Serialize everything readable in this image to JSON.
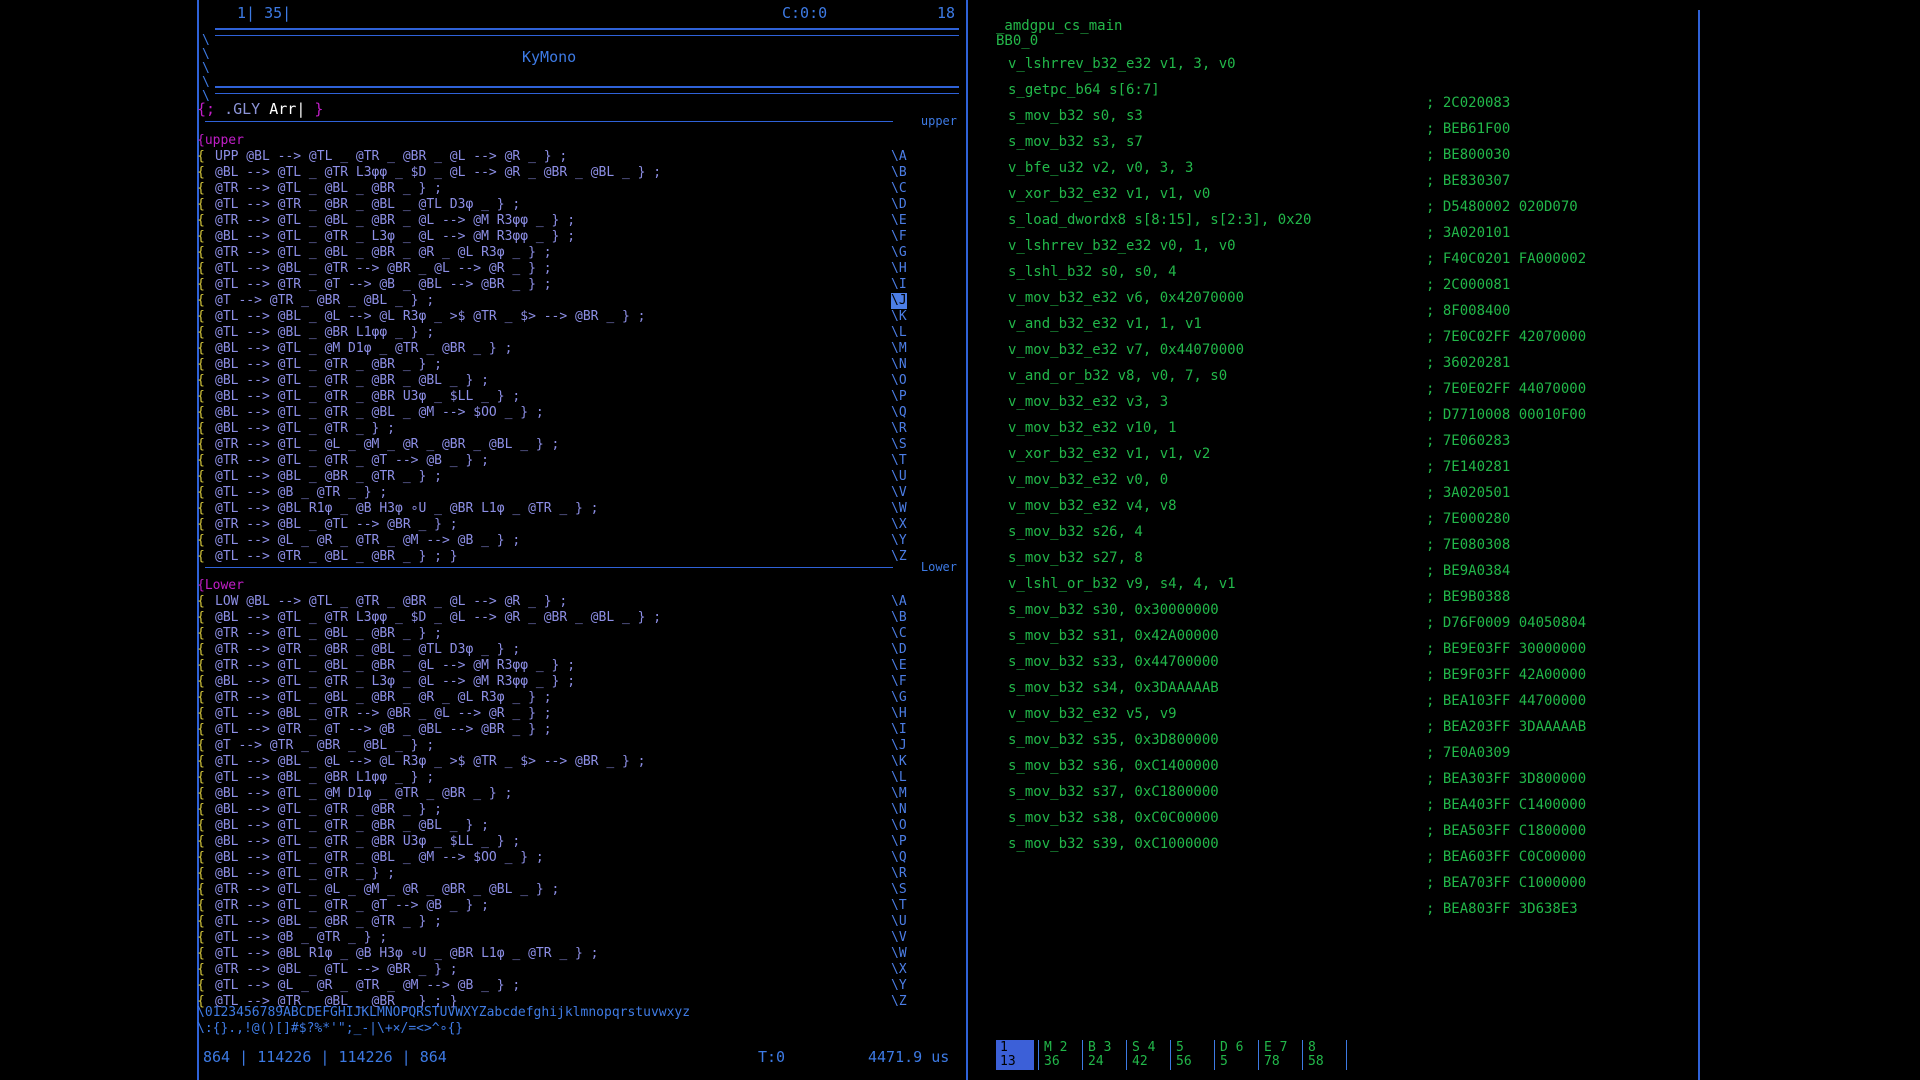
{
  "left_status": {
    "line": "1",
    "col": "35",
    "cursor": "C:0:0",
    "count": "18"
  },
  "title": "KyMono",
  "glyph_line": {
    "open": "{;",
    "text": " .GLY ",
    "name": "Arr|",
    "close": "}"
  },
  "sections": [
    {
      "label": "upper",
      "tag": "upper",
      "lines": [
        {
          "code": "UPP @BL --> @TL _ @TR _ @BR _ @L --> @R _ } ;",
          "gutter": "\\A"
        },
        {
          "code": "@BL --> @TL _ @TR L3φφ _ $D _ @L --> @R _ @BR _ @BL _ } ;",
          "gutter": "\\B"
        },
        {
          "code": "@TR --> @TL _ @BL _ @BR _ } ;",
          "gutter": "\\C"
        },
        {
          "code": "@TL --> @TR _ @BR _ @BL _ @TL D3φ _ } ;",
          "gutter": "\\D"
        },
        {
          "code": "@TR --> @TL _ @BL _ @BR _ @L --> @M R3φφ _ } ;",
          "gutter": "\\E"
        },
        {
          "code": "@BL --> @TL _ @TR _ L3φ _ @L --> @M R3φφ _ } ;",
          "gutter": "\\F"
        },
        {
          "code": "@TR --> @TL _ @BL _ @BR _ @R _ @L R3φ _ } ;",
          "gutter": "\\G"
        },
        {
          "code": "@TL --> @BL _ @TR --> @BR _ @L --> @R _ } ;",
          "gutter": "\\H"
        },
        {
          "code": "@TL --> @TR _ @T --> @B _ @BL --> @BR _ } ;",
          "gutter": "\\I"
        },
        {
          "code": "@T --> @TR _ @BR _ @BL _ } ;",
          "gutter": "\\J",
          "sel": true
        },
        {
          "code": "@TL --> @BL _ @L --> @L R3φ _ >$ @TR _ $> --> @BR _ } ;",
          "gutter": "\\K"
        },
        {
          "code": "@TL --> @BL _ @BR L1φφ _ } ;",
          "gutter": "\\L"
        },
        {
          "code": "@BL --> @TL _ @M D1φ _ @TR _ @BR _ } ;",
          "gutter": "\\M"
        },
        {
          "code": "@BL --> @TL _ @TR _ @BR _ } ;",
          "gutter": "\\N"
        },
        {
          "code": "@BL --> @TL _ @TR _ @BR _ @BL _ } ;",
          "gutter": "\\O"
        },
        {
          "code": "@BL --> @TL _ @TR _ @BR U3φ _ $LL _ } ;",
          "gutter": "\\P"
        },
        {
          "code": "@BL --> @TL _ @TR _ @BL _ @M --> $OO _ } ;",
          "gutter": "\\Q"
        },
        {
          "code": "@BL --> @TL _ @TR _ } ;",
          "gutter": "\\R"
        },
        {
          "code": "@TR --> @TL _ @L _ @M _ @R _ @BR _ @BL _ } ;",
          "gutter": "\\S"
        },
        {
          "code": "@TR --> @TL _ @TR _ @T --> @B _ } ;",
          "gutter": "\\T"
        },
        {
          "code": "@TL --> @BL _ @BR _ @TR _ } ;",
          "gutter": "\\U"
        },
        {
          "code": "@TL --> @B _ @TR _ } ;",
          "gutter": "\\V"
        },
        {
          "code": "@TL --> @BL R1φ _ @B H3φ ∘U _ @BR L1φ _ @TR _ } ;",
          "gutter": "\\W"
        },
        {
          "code": "@TR --> @BL _ @TL --> @BR _ } ;",
          "gutter": "\\X"
        },
        {
          "code": "@TL --> @L _ @R _ @TR _ @M --> @B _ } ;",
          "gutter": "\\Y"
        },
        {
          "code": "@TL --> @TR _ @BL _ @BR _ } ; }",
          "gutter": "\\Z"
        }
      ]
    },
    {
      "label": "Lower",
      "tag": "Lower",
      "lines": [
        {
          "code": "LOW @BL --> @TL _ @TR _ @BR _ @L --> @R _ } ;",
          "gutter": "\\A"
        },
        {
          "code": "@BL --> @TL _ @TR L3φφ _ $D _ @L --> @R _ @BR _ @BL _ } ;",
          "gutter": "\\B"
        },
        {
          "code": "@TR --> @TL _ @BL _ @BR _ } ;",
          "gutter": "\\C"
        },
        {
          "code": "@TR --> @TR _ @BR _ @BL _ @TL D3φ _ } ;",
          "gutter": "\\D"
        },
        {
          "code": "@TR --> @TL _ @BL _ @BR _ @L --> @M R3φφ _ } ;",
          "gutter": "\\E"
        },
        {
          "code": "@BL --> @TL _ @TR _ L3φ _ @L --> @M R3φφ _ } ;",
          "gutter": "\\F"
        },
        {
          "code": "@TR --> @TL _ @BL _ @BR _ @R _ @L R3φ _ } ;",
          "gutter": "\\G"
        },
        {
          "code": "@TL --> @BL _ @TR --> @BR _ @L --> @R _ } ;",
          "gutter": "\\H"
        },
        {
          "code": "@TL --> @TR _ @T --> @B _ @BL --> @BR _ } ;",
          "gutter": "\\I"
        },
        {
          "code": "@T --> @TR _ @BR _ @BL _ } ;",
          "gutter": "\\J"
        },
        {
          "code": "@TL --> @BL _ @L --> @L R3φ _ >$ @TR _ $> --> @BR _ } ;",
          "gutter": "\\K"
        },
        {
          "code": "@TL --> @BL _ @BR L1φφ _ } ;",
          "gutter": "\\L"
        },
        {
          "code": "@BL --> @TL _ @M D1φ _ @TR _ @BR _ } ;",
          "gutter": "\\M"
        },
        {
          "code": "@BL --> @TL _ @TR _ @BR _ } ;",
          "gutter": "\\N"
        },
        {
          "code": "@BL --> @TL _ @TR _ @BR _ @BL _ } ;",
          "gutter": "\\O"
        },
        {
          "code": "@BL --> @TL _ @TR _ @BR U3φ _ $LL _ } ;",
          "gutter": "\\P"
        },
        {
          "code": "@BL --> @TL _ @TR _ @BL _ @M --> $OO _ } ;",
          "gutter": "\\Q"
        },
        {
          "code": "@BL --> @TL _ @TR _ } ;",
          "gutter": "\\R"
        },
        {
          "code": "@TR --> @TL _ @L _ @M _ @R _ @BR _ @BL _ } ;",
          "gutter": "\\S"
        },
        {
          "code": "@TR --> @TL _ @TR _ @T --> @B _ } ;",
          "gutter": "\\T"
        },
        {
          "code": "@TL --> @BL _ @BR _ @TR _ } ;",
          "gutter": "\\U"
        },
        {
          "code": "@TL --> @B _ @TR _ } ;",
          "gutter": "\\V"
        },
        {
          "code": "@TL --> @BL R1φ _ @B H3φ ∘U _ @BR L1φ _ @TR _ } ;",
          "gutter": "\\W"
        },
        {
          "code": "@TR --> @BL _ @TL --> @BR _ } ;",
          "gutter": "\\X"
        },
        {
          "code": "@TL --> @L _ @R _ @TR _ @M --> @B _ } ;",
          "gutter": "\\Y"
        },
        {
          "code": "@TL --> @TR _ @BL _ @BR _ } ; }",
          "gutter": "\\Z"
        }
      ]
    }
  ],
  "charset": [
    "\\0123456789ABCDEFGHIJKLMNOPQRSTUVWXYZabcdefghijklmnopqrstuvwxyz",
    "\\:{}.,!@()[]#$?%*'\";_-|\\+×/=<>^∘{}"
  ],
  "left_bottom_status": {
    "a": "864",
    "b": "114226",
    "c": "114226",
    "d": "864",
    "t": "T:0",
    "speed": "4471.9 us"
  },
  "right": {
    "kernel": "_amdgpu_cs_main",
    "block": "BB0_0",
    "instructions": [
      {
        "asm": "v_lshrrev_b32_e32 v1, 3, v0",
        "enc": ""
      },
      {
        "asm": "s_getpc_b64 s[6:7]",
        "enc": "; 2C020083"
      },
      {
        "asm": "s_mov_b32 s0, s3",
        "enc": "; BEB61F00"
      },
      {
        "asm": "s_mov_b32 s3, s7",
        "enc": "; BE800030"
      },
      {
        "asm": "v_bfe_u32 v2, v0, 3, 3",
        "enc": "; BE830307"
      },
      {
        "asm": "v_xor_b32_e32 v1, v1, v0",
        "enc": "; D5480002 020D070"
      },
      {
        "asm": "s_load_dwordx8 s[8:15], s[2:3], 0x20",
        "enc": "; 3A020101"
      },
      {
        "asm": "v_lshrrev_b32_e32 v0, 1, v0",
        "enc": "; F40C0201 FA000002"
      },
      {
        "asm": "s_lshl_b32 s0, s0, 4",
        "enc": "; 2C000081"
      },
      {
        "asm": "v_mov_b32_e32 v6, 0x42070000",
        "enc": "; 8F008400"
      },
      {
        "asm": "v_and_b32_e32 v1, 1, v1",
        "enc": "; 7E0C02FF 42070000"
      },
      {
        "asm": "v_mov_b32_e32 v7, 0x44070000",
        "enc": "; 36020281"
      },
      {
        "asm": "v_and_or_b32 v8, v0, 7, s0",
        "enc": "; 7E0E02FF 44070000"
      },
      {
        "asm": "v_mov_b32_e32 v3, 3",
        "enc": "; D7710008 00010F00"
      },
      {
        "asm": "v_mov_b32_e32 v10, 1",
        "enc": "; 7E060283"
      },
      {
        "asm": "v_xor_b32_e32 v1, v1, v2",
        "enc": "; 7E140281"
      },
      {
        "asm": "v_mov_b32_e32 v0, 0",
        "enc": "; 3A020501"
      },
      {
        "asm": "v_mov_b32_e32 v4, v8",
        "enc": "; 7E000280"
      },
      {
        "asm": "s_mov_b32 s26, 4",
        "enc": "; 7E080308"
      },
      {
        "asm": "s_mov_b32 s27, 8",
        "enc": "; BE9A0384"
      },
      {
        "asm": "v_lshl_or_b32 v9, s4, 4, v1",
        "enc": "; BE9B0388"
      },
      {
        "asm": "s_mov_b32 s30, 0x30000000",
        "enc": "; D76F0009 04050804"
      },
      {
        "asm": "s_mov_b32 s31, 0x42A00000",
        "enc": "; BE9E03FF 30000000"
      },
      {
        "asm": "s_mov_b32 s33, 0x44700000",
        "enc": "; BE9F03FF 42A00000"
      },
      {
        "asm": "s_mov_b32 s34, 0x3DAAAAAB",
        "enc": "; BEA103FF 44700000"
      },
      {
        "asm": "v_mov_b32_e32 v5, v9",
        "enc": "; BEA203FF 3DAAAAAB"
      },
      {
        "asm": "s_mov_b32 s35, 0x3D800000",
        "enc": "; 7E0A0309"
      },
      {
        "asm": "s_mov_b32 s36, 0xC1400000",
        "enc": "; BEA303FF 3D800000"
      },
      {
        "asm": "s_mov_b32 s37, 0xC1800000",
        "enc": "; BEA403FF C1400000"
      },
      {
        "asm": "s_mov_b32 s38, 0xC0C00000",
        "enc": "; BEA503FF C1800000"
      },
      {
        "asm": "s_mov_b32 s39, 0xC1000000",
        "enc": "; BEA603FF C0C00000"
      },
      {
        "asm": "",
        "enc": "; BEA703FF C1000000"
      },
      {
        "asm": "",
        "enc": "; BEA803FF 3D638E3"
      }
    ],
    "reg_strip": [
      {
        "a": "1",
        "b": "13",
        "active": true
      },
      {
        "a": "M 2",
        "b": "36"
      },
      {
        "a": "B 3",
        "b": "24"
      },
      {
        "a": "S 4",
        "b": "42"
      },
      {
        "a": "5",
        "b": "56"
      },
      {
        "a": "D 6",
        "b": "5"
      },
      {
        "a": "E 7",
        "b": "78"
      },
      {
        "a": "8",
        "b": "58"
      }
    ]
  }
}
